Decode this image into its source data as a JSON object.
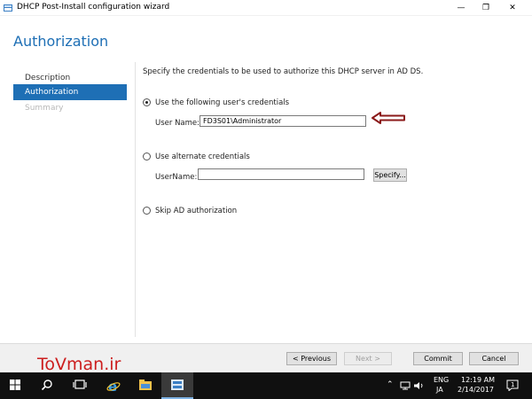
{
  "window": {
    "title": "DHCP Post-Install configuration wizard",
    "minimize_glyph": "—",
    "maximize_glyph": "❐",
    "close_glyph": "✕"
  },
  "page": {
    "heading": "Authorization"
  },
  "nav": {
    "items": [
      {
        "label": "Description",
        "state": "normal"
      },
      {
        "label": "Authorization",
        "state": "selected"
      },
      {
        "label": "Summary",
        "state": "disabled"
      }
    ]
  },
  "content": {
    "intro": "Specify the credentials to be used to authorize this DHCP server in AD DS.",
    "option_user": {
      "label": "Use the following user's credentials",
      "checked": true,
      "field_label": "User Name:",
      "field_value": "FD3S01\\Administrator"
    },
    "option_alternate": {
      "label": "Use alternate credentials",
      "checked": false,
      "field_label": "UserName:",
      "field_value": "",
      "specify_label": "Specify..."
    },
    "option_skip": {
      "label": "Skip AD authorization",
      "checked": false
    }
  },
  "footer": {
    "previous_label": "< Previous",
    "next_label": "Next >",
    "commit_label": "Commit",
    "cancel_label": "Cancel"
  },
  "watermark": {
    "text": "ToVman.ir"
  },
  "taskbar": {
    "icons": [
      "windows-start-icon",
      "search-icon",
      "task-view-icon",
      "internet-explorer-icon",
      "file-explorer-icon",
      "server-manager-icon"
    ],
    "tray": {
      "language": "ENG",
      "keyboard": "JA",
      "time": "12:19 AM",
      "date": "2/14/2017",
      "notifications_count": "1"
    }
  },
  "colors": {
    "accent": "#1e6fb5",
    "watermark": "#cc1e1e",
    "arrow": "#8b1a1a",
    "taskbar": "#101010"
  }
}
